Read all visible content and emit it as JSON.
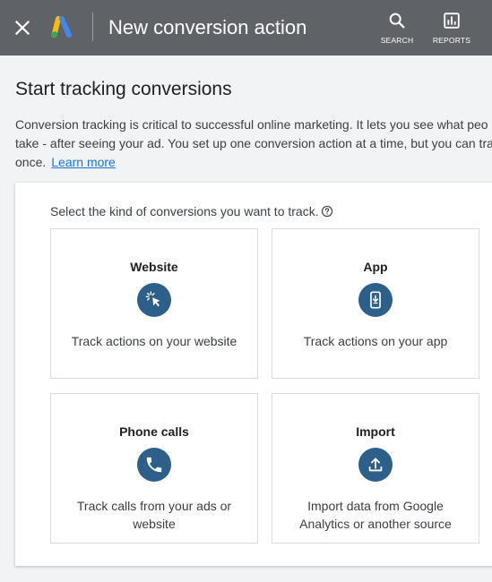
{
  "header": {
    "title": "New conversion action",
    "close_icon": "close-icon",
    "logo_icon": "google-ads-logo",
    "search_label": "SEARCH",
    "reports_label": "REPORTS",
    "colors": {
      "bar": "#5f6368",
      "text": "#ffffff"
    }
  },
  "main": {
    "title": "Start tracking conversions",
    "description_line1": "Conversion tracking is critical to successful online marketing. It lets you see what peo",
    "description_line2": "take - after seeing your ad. You set up one conversion action at a time, but you can tra",
    "description_line3": "once.",
    "learn_more": "Learn more"
  },
  "panel": {
    "prompt": "Select the kind of conversions you want to track.",
    "help_icon": "help-circle-icon",
    "cards": [
      {
        "title": "Website",
        "icon": "cursor-click-icon",
        "description": "Track actions on your website"
      },
      {
        "title": "App",
        "icon": "smartphone-download-icon",
        "description": "Track actions on your app"
      },
      {
        "title": "Phone calls",
        "icon": "phone-icon",
        "description": "Track calls from your ads or website"
      },
      {
        "title": "Import",
        "icon": "upload-icon",
        "description": "Import data from Google Analytics or another source"
      }
    ],
    "colors": {
      "icon_circle": "#2c5f8a",
      "link": "#1a73e8"
    }
  }
}
